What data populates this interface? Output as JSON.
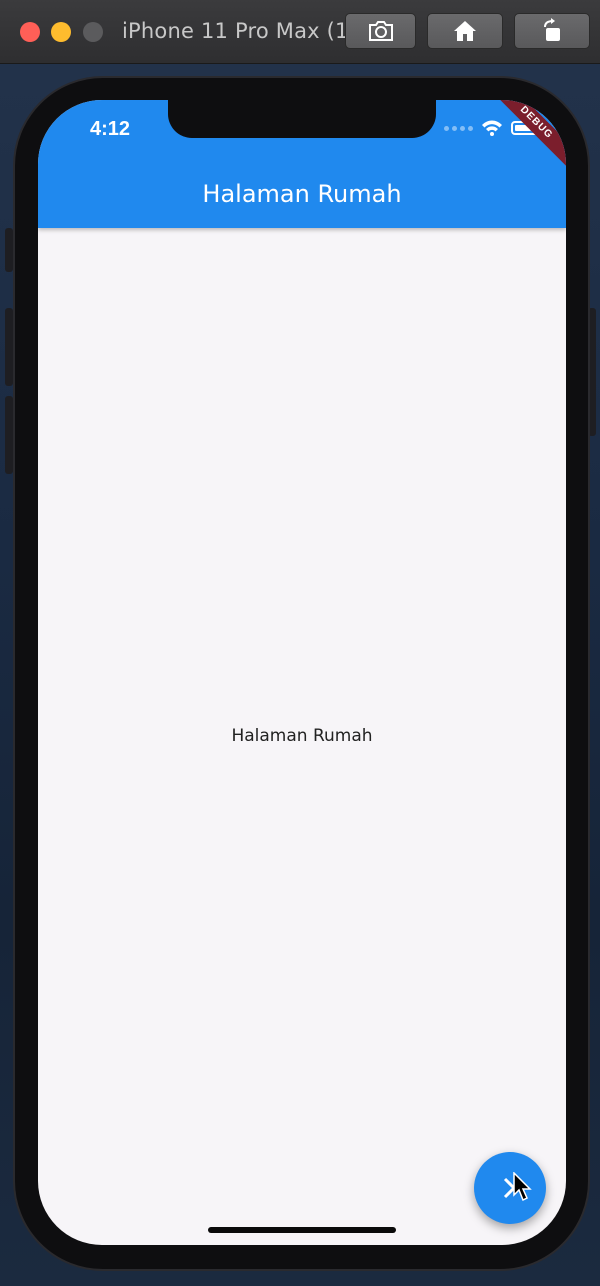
{
  "window": {
    "title": "iPhone 11 Pro Max (1..."
  },
  "toolbar": {
    "screenshot_icon": "camera-icon",
    "home_icon": "home-icon",
    "rotate_icon": "rotate-icon"
  },
  "status_bar": {
    "time": "4:12",
    "wifi_icon": "wifi-icon",
    "battery_icon": "battery-icon"
  },
  "debug_banner": "DEBUG",
  "app_bar": {
    "title": "Halaman Rumah",
    "color": "#2089EE"
  },
  "body": {
    "text": "Halaman Rumah"
  },
  "fab": {
    "icon": "arrow-forward-icon"
  }
}
